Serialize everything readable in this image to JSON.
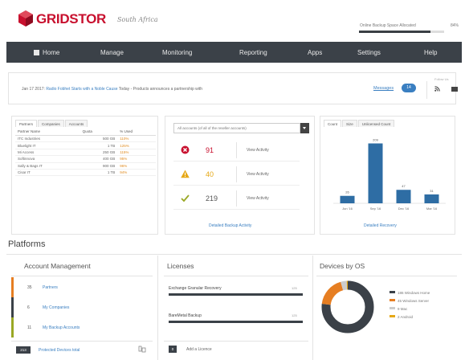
{
  "header": {
    "logo_text": "GRIDSTOR",
    "logo_tagline": "South Africa",
    "storage_label": "Online Backup Space Allocated",
    "storage_pct": "84%",
    "storage_fraction": 0.84,
    "brand_color": "#c8102e"
  },
  "nav": {
    "items": [
      {
        "label": "Home",
        "icon": "home-icon"
      },
      {
        "label": "Manage"
      },
      {
        "label": "Monitoring"
      },
      {
        "label": "Reporting"
      },
      {
        "label": "Apps"
      },
      {
        "label": "Settings"
      },
      {
        "label": "Help"
      }
    ]
  },
  "news": {
    "date": "Jan 17 2017:",
    "headline_link": "Radio Fobhet Starts with a Noble Cause",
    "rest": "Today - Products announces a partnership with",
    "messages_label": "Messages",
    "messages_count": "14",
    "social_label": "Follow Us",
    "icons": [
      "rss-icon",
      "mail-icon"
    ]
  },
  "partners_panel": {
    "tabs": [
      "Partners",
      "Companies",
      "Accounts"
    ],
    "columns": [
      "Partner Name",
      "Quota",
      "% Used"
    ],
    "rows": [
      [
        "ITC Industries",
        "500 GB",
        "110%"
      ],
      [
        "Bluelight IT",
        "1 TB",
        "125%"
      ],
      [
        "Mi Access",
        "250 GB",
        "115%"
      ],
      [
        "Softinnova",
        "400 GB",
        "95%"
      ],
      [
        "Sally & Bags IT",
        "900 GB",
        "96%"
      ],
      [
        "Cisar IT",
        "1 TB",
        "94%"
      ]
    ]
  },
  "activity_panel": {
    "select_value": "All accounts (of all of the reseller accounts)",
    "rows": [
      {
        "icon": "error-icon",
        "count": "91",
        "link": "View Activity",
        "color": "#c8102e"
      },
      {
        "icon": "warning-icon",
        "count": "40",
        "link": "View Activity",
        "color": "#e6a817"
      },
      {
        "icon": "check-icon",
        "count": "219",
        "link": "View Activity",
        "color": "#555555"
      }
    ],
    "detail_link": "Detailed Backup Activity"
  },
  "chart_panel": {
    "tabs": [
      "Count",
      "Size",
      "Unlicensed Count"
    ],
    "detail_link": "Detailed Recovery",
    "accent": "#2e6da4"
  },
  "chart_data": {
    "type": "bar",
    "categories": [
      "Jun '16",
      "Sep '16",
      "Dec '16",
      "Mar '16"
    ],
    "values": [
      26,
      209,
      47,
      31
    ],
    "ylim": [
      0,
      230
    ],
    "title": "",
    "xlabel": "",
    "ylabel": ""
  },
  "platforms": {
    "title": "Platforms",
    "account_management": {
      "title": "Account Management",
      "rows": [
        {
          "count": "35",
          "label": "Partners",
          "color": "#e67e22"
        },
        {
          "count": "6",
          "label": "My Companies",
          "color": "#3b4148"
        },
        {
          "count": "11",
          "label": "My Backup Accounts",
          "color": "#9aa825"
        }
      ],
      "bottom_count": "213",
      "bottom_link": "Protected Devices total"
    },
    "licenses": {
      "title": "Licenses",
      "items": [
        {
          "name": "Exchange Granular Recovery",
          "count": "125",
          "fraction": 1.0
        },
        {
          "name": "BareMetal Backup",
          "count": "125",
          "fraction": 1.0
        }
      ],
      "bottom_count": "0",
      "bottom_text": "Add a Licence"
    },
    "devices": {
      "title": "Devices by OS",
      "legend": [
        {
          "count": "186",
          "label": "Windows Home",
          "color": "#3b4148",
          "value": 186
        },
        {
          "count": "45",
          "label": "Windows Server",
          "color": "#e67e22",
          "value": 45
        },
        {
          "count": "9",
          "label": "Mac",
          "color": "#cccccc",
          "value": 9
        },
        {
          "count": "2",
          "label": "Android",
          "color": "#e6a817",
          "value": 2
        }
      ]
    }
  }
}
